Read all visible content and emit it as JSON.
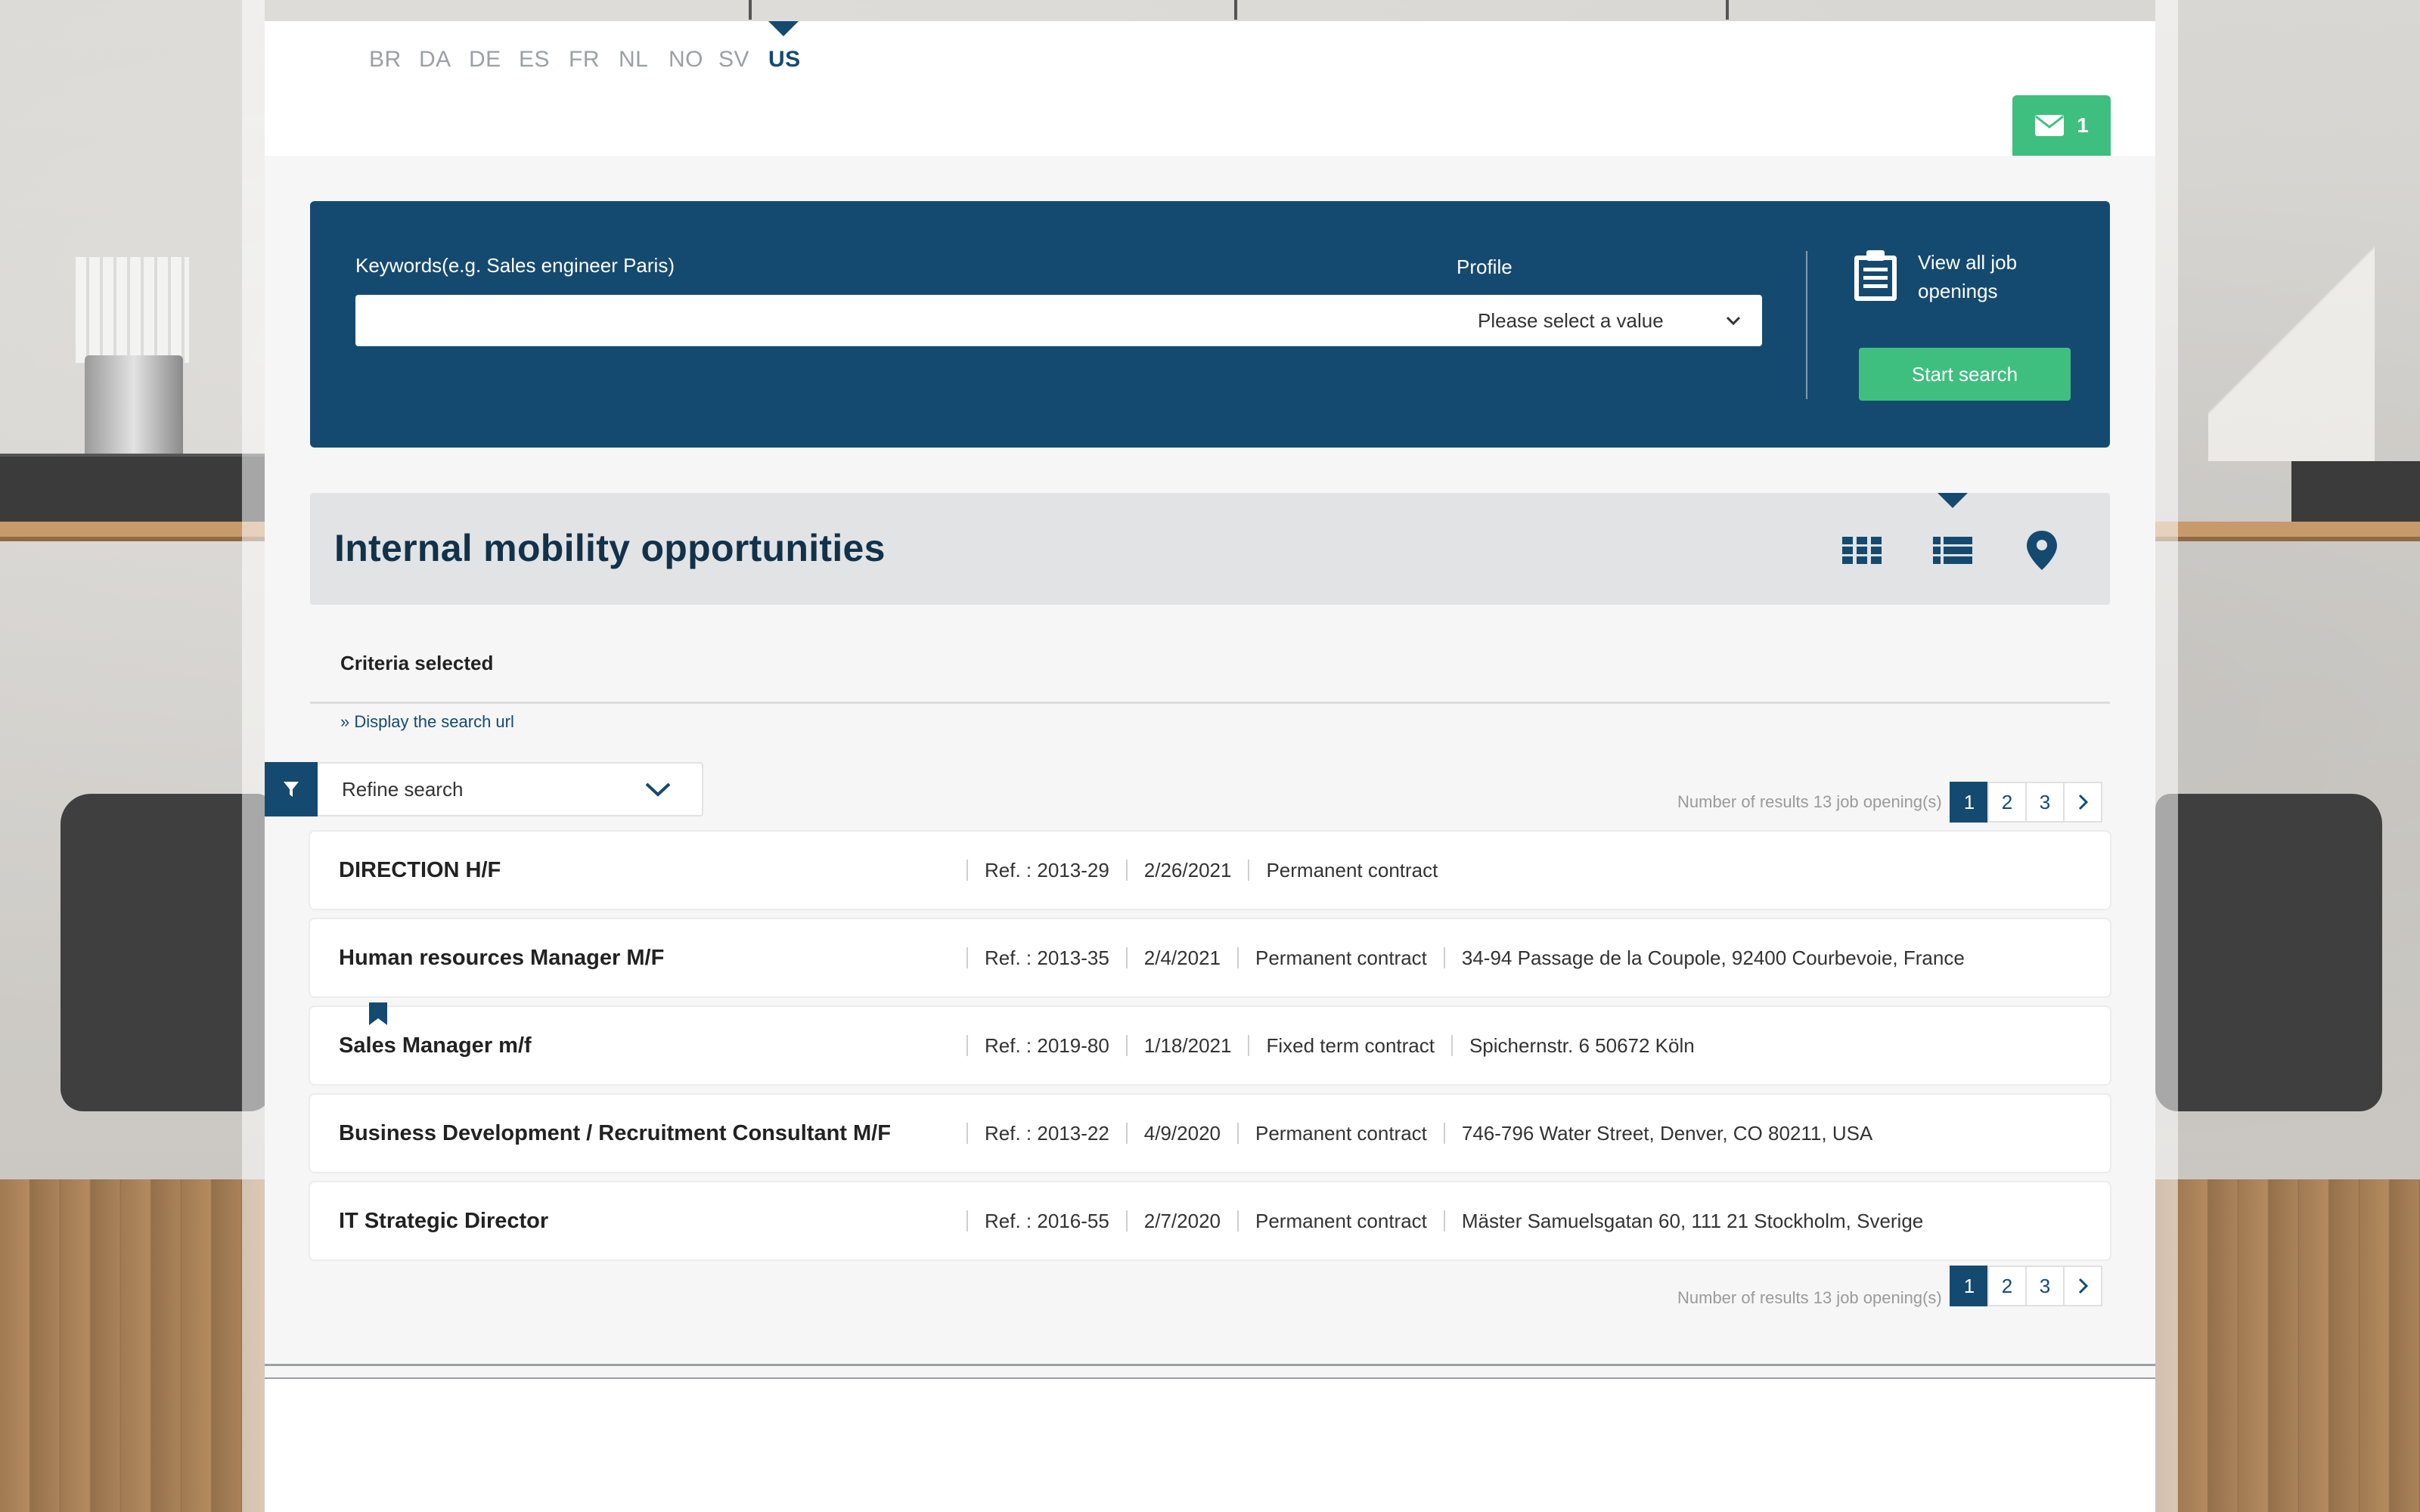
{
  "languages": [
    {
      "code": "BR",
      "active": false
    },
    {
      "code": "DA",
      "active": false
    },
    {
      "code": "DE",
      "active": false
    },
    {
      "code": "ES",
      "active": false
    },
    {
      "code": "FR",
      "active": false
    },
    {
      "code": "NL",
      "active": false
    },
    {
      "code": "NO",
      "active": false
    },
    {
      "code": "SV",
      "active": false
    },
    {
      "code": "US",
      "active": true
    }
  ],
  "mail": {
    "count": "1",
    "icon": "envelope-icon"
  },
  "search": {
    "keywords_label": "Keywords(e.g. Sales engineer Paris)",
    "keywords_value": "",
    "profile_label": "Profile",
    "profile_selected": "Please select a value",
    "view_all_label": "View all job openings",
    "start_button": "Start search"
  },
  "mobility": {
    "title": "Internal mobility opportunities",
    "views": [
      "grid-view-icon",
      "list-view-icon",
      "map-pin-icon"
    ],
    "active_view": "list-view-icon"
  },
  "criteria": {
    "label": "Criteria selected",
    "search_url_link": "» Display the search url"
  },
  "refine": {
    "label": "Refine search"
  },
  "results": {
    "count_text": "Number of results 13 job opening(s)",
    "pages": [
      "1",
      "2",
      "3"
    ],
    "current_page": "1"
  },
  "jobs": [
    {
      "title": "DIRECTION H/F",
      "ref": "Ref. : 2013-29",
      "date": "2/26/2021",
      "contract": "Permanent contract",
      "location": "",
      "bookmarked": false
    },
    {
      "title": "Human resources Manager M/F",
      "ref": "Ref. : 2013-35",
      "date": "2/4/2021",
      "contract": "Permanent contract",
      "location": "34-94 Passage de la Coupole, 92400 Courbevoie, France",
      "bookmarked": false
    },
    {
      "title": "Sales Manager m/f",
      "ref": "Ref. : 2019-80",
      "date": "1/18/2021",
      "contract": "Fixed term contract",
      "location": "Spichernstr. 6 50672 Köln",
      "bookmarked": true
    },
    {
      "title": "Business Development / Recruitment Consultant M/F",
      "ref": "Ref. : 2013-22",
      "date": "4/9/2020",
      "contract": "Permanent contract",
      "location": "746-796 Water Street, Denver, CO 80211, USA",
      "bookmarked": false
    },
    {
      "title": "IT Strategic Director",
      "ref": "Ref. : 2016-55",
      "date": "2/7/2020",
      "contract": "Permanent contract",
      "location": "Mäster Samuelsgatan 60, 111 21 Stockholm, Sverige",
      "bookmarked": false
    }
  ],
  "colors": {
    "primary": "#154a70",
    "accent_green": "#3fbf7f",
    "header_bar": "#e2e3e5",
    "muted_text": "#9aa0a6"
  }
}
